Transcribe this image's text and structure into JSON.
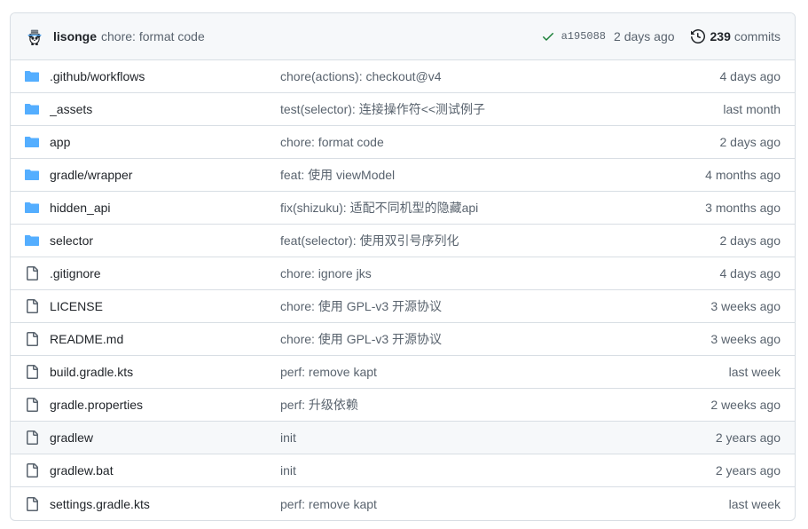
{
  "latest_commit": {
    "author": "lisonge",
    "message": "chore: format code",
    "status_icon": "check-icon",
    "sha": "a195088",
    "date": "2 days ago",
    "history_icon": "history-icon",
    "commits_count": "239",
    "commits_label": "commits"
  },
  "colors": {
    "folder_blue": "#54aeff",
    "file_gray": "#59636e",
    "check_green": "#1a7f37",
    "border": "#d8dee4",
    "header_bg": "#f6f8fa",
    "hover_bg": "#f6f8fa",
    "text_primary": "#1f2328",
    "text_muted": "#59636e"
  },
  "files": [
    {
      "icon": "folder-icon",
      "type": "folder",
      "name": ".github/workflows",
      "commit": "chore(actions): checkout@v4",
      "age": "4 days ago",
      "hovered": false
    },
    {
      "icon": "folder-icon",
      "type": "folder",
      "name": "_assets",
      "commit": "test(selector): 连接操作符<<测试例子",
      "age": "last month",
      "hovered": false
    },
    {
      "icon": "folder-icon",
      "type": "folder",
      "name": "app",
      "commit": "chore: format code",
      "age": "2 days ago",
      "hovered": false
    },
    {
      "icon": "folder-icon",
      "type": "folder",
      "name": "gradle/wrapper",
      "commit": "feat: 使用 viewModel",
      "age": "4 months ago",
      "hovered": false
    },
    {
      "icon": "folder-icon",
      "type": "folder",
      "name": "hidden_api",
      "commit": "fix(shizuku): 适配不同机型的隐藏api",
      "age": "3 months ago",
      "hovered": false
    },
    {
      "icon": "folder-icon",
      "type": "folder",
      "name": "selector",
      "commit": "feat(selector): 使用双引号序列化",
      "age": "2 days ago",
      "hovered": false
    },
    {
      "icon": "file-icon",
      "type": "file",
      "name": ".gitignore",
      "commit": "chore: ignore jks",
      "age": "4 days ago",
      "hovered": false
    },
    {
      "icon": "file-icon",
      "type": "file",
      "name": "LICENSE",
      "commit": "chore: 使用 GPL-v3 开源协议",
      "age": "3 weeks ago",
      "hovered": false
    },
    {
      "icon": "file-icon",
      "type": "file",
      "name": "README.md",
      "commit": "chore: 使用 GPL-v3 开源协议",
      "age": "3 weeks ago",
      "hovered": false
    },
    {
      "icon": "file-icon",
      "type": "file",
      "name": "build.gradle.kts",
      "commit": "perf: remove kapt",
      "age": "last week",
      "hovered": false
    },
    {
      "icon": "file-icon",
      "type": "file",
      "name": "gradle.properties",
      "commit": "perf: 升级依赖",
      "age": "2 weeks ago",
      "hovered": false
    },
    {
      "icon": "file-icon",
      "type": "file",
      "name": "gradlew",
      "commit": "init",
      "age": "2 years ago",
      "hovered": true
    },
    {
      "icon": "file-icon",
      "type": "file",
      "name": "gradlew.bat",
      "commit": "init",
      "age": "2 years ago",
      "hovered": false
    },
    {
      "icon": "file-icon",
      "type": "file",
      "name": "settings.gradle.kts",
      "commit": "perf: remove kapt",
      "age": "last week",
      "hovered": false
    }
  ]
}
